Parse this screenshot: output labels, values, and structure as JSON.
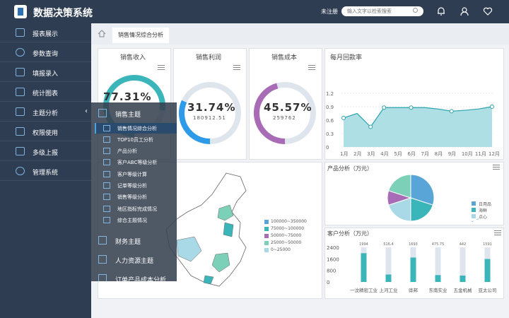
{
  "app": {
    "title": "数据决策系统",
    "login": "未注册",
    "search_placeholder": "输入文字以检索搜索"
  },
  "topbar": {
    "icons": [
      "bell-icon",
      "user-icon",
      "heart-icon"
    ]
  },
  "sidebar": {
    "items": [
      {
        "label": "报表展示",
        "icon": "list-icon"
      },
      {
        "label": "参数查询",
        "icon": "search-icon"
      },
      {
        "label": "填报录入",
        "icon": "edit-icon"
      },
      {
        "label": "统计图表",
        "icon": "table-icon"
      },
      {
        "label": "主题分析",
        "icon": "chart-icon"
      },
      {
        "label": "权限使用",
        "icon": "monitor-icon"
      },
      {
        "label": "多级上报",
        "icon": "bar-icon"
      },
      {
        "label": "管理系统",
        "icon": "gear-icon"
      }
    ]
  },
  "breadcrumb": {
    "tab": "销售情况综合分析"
  },
  "submenu": {
    "group1": "销售主题",
    "items": [
      "销售情况综合分析",
      "TOP10员工分析",
      "产品分析",
      "客户ABC等级分析",
      "客户等级计算",
      "记单等级分析",
      "销售等级分析",
      "地区指标完成情况",
      "综合主题情况"
    ],
    "group2": "财务主题",
    "group3": "人力资源主题",
    "group4": "订单产品成本分析"
  },
  "kpis": [
    {
      "title": "销售收入",
      "value": "77.31%",
      "sub": "",
      "fraction": 0.7731,
      "color": "#3ab5b9"
    },
    {
      "title": "销售利润",
      "value": "31.74%",
      "sub": "180912.51",
      "fraction": 0.3174,
      "color": "#2d9be8"
    },
    {
      "title": "销售成本",
      "value": "45.57%",
      "sub": "259762",
      "fraction": 0.4557,
      "color": "#a86bb5"
    }
  ],
  "line_card": {
    "title": "每月回款率"
  },
  "map_legend": [
    "100000~350000",
    "75000~100000",
    "50000~75000",
    "25000~50000",
    "0~25000"
  ],
  "pie_card": {
    "title": "产品分析（万元）",
    "legend": [
      "日用品",
      "海鲜",
      "点心"
    ]
  },
  "bar_card": {
    "title": "客户分析（万元）"
  },
  "chart_data": [
    {
      "type": "line",
      "categories": [
        "1月",
        "2月",
        "3月",
        "4月",
        "5月",
        "6月",
        "7月",
        "8月",
        "9月",
        "10月",
        "11月",
        "12月"
      ],
      "values": [
        0.65,
        0.75,
        0.45,
        0.88,
        0.88,
        0.88,
        0.88,
        0.85,
        0.8,
        0.82,
        0.85,
        0.9
      ],
      "yticks": [
        "1.2",
        "0.9",
        "0.6",
        "0.3",
        "0"
      ],
      "ylim": [
        0,
        1.2
      ]
    },
    {
      "type": "pie",
      "slices": [
        {
          "name": "日用品",
          "value": 30,
          "color": "#5aa5d8"
        },
        {
          "name": "海鲜",
          "value": 20,
          "color": "#3ab5b9"
        },
        {
          "name": "点心",
          "value": 20,
          "color": "#a9d9e6"
        },
        {
          "name": "",
          "value": 10,
          "color": "#a86bb5"
        },
        {
          "name": "",
          "value": 20,
          "color": "#7dd0b8"
        }
      ]
    },
    {
      "type": "bar",
      "categories": [
        "一汶精密工业",
        "上河工业",
        "骅邦",
        "东南实业",
        "五金机械",
        "亚太公司"
      ],
      "labels": [
        "1994",
        "516.4",
        "1693",
        "475.75",
        "442",
        "1591"
      ],
      "values": [
        1994,
        516.4,
        1693,
        475.75,
        442,
        1591
      ],
      "yticks": [
        "2400",
        "1600",
        "800",
        "0"
      ],
      "ylim": [
        0,
        2400
      ]
    }
  ]
}
